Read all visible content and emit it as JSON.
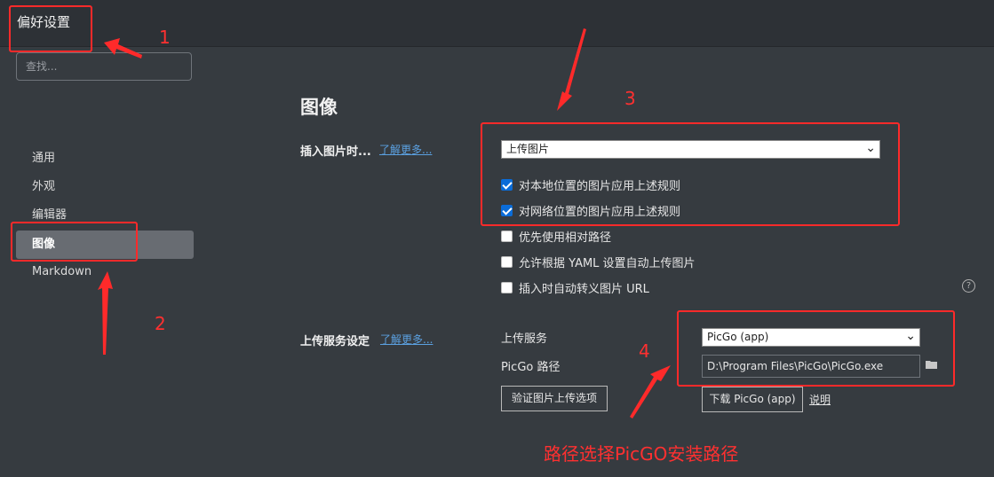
{
  "window": {
    "title": "偏好设置"
  },
  "sidebar": {
    "search_placeholder": "查找...",
    "items": [
      {
        "label": "通用",
        "active": false
      },
      {
        "label": "外观",
        "active": false
      },
      {
        "label": "编辑器",
        "active": false
      },
      {
        "label": "图像",
        "active": true
      },
      {
        "label": "Markdown",
        "active": false
      }
    ]
  },
  "main": {
    "section_title": "图像",
    "insert": {
      "label": "插入图片时...",
      "learn_more": "了解更多...",
      "action_select": "上传图片",
      "options": [
        {
          "label": "对本地位置的图片应用上述规则",
          "checked": true
        },
        {
          "label": "对网络位置的图片应用上述规则",
          "checked": true
        },
        {
          "label": "优先使用相对路径",
          "checked": false
        },
        {
          "label": "允许根据 YAML 设置自动上传图片",
          "checked": false
        },
        {
          "label": "插入时自动转义图片 URL",
          "checked": false
        }
      ]
    },
    "upload": {
      "label": "上传服务设定",
      "learn_more": "了解更多...",
      "service_label": "上传服务",
      "service_value": "PicGo (app)",
      "path_label": "PicGo 路径",
      "path_value": "D:\\Program Files\\PicGo\\PicGo.exe",
      "verify_button": "验证图片上传选项",
      "download_button": "下载 PicGo (app)",
      "explain_link": "说明"
    }
  },
  "annotations": {
    "numbers": [
      "1",
      "2",
      "3",
      "4"
    ],
    "caption": "路径选择PicGO安装路径",
    "color": "#ff2a2a"
  }
}
